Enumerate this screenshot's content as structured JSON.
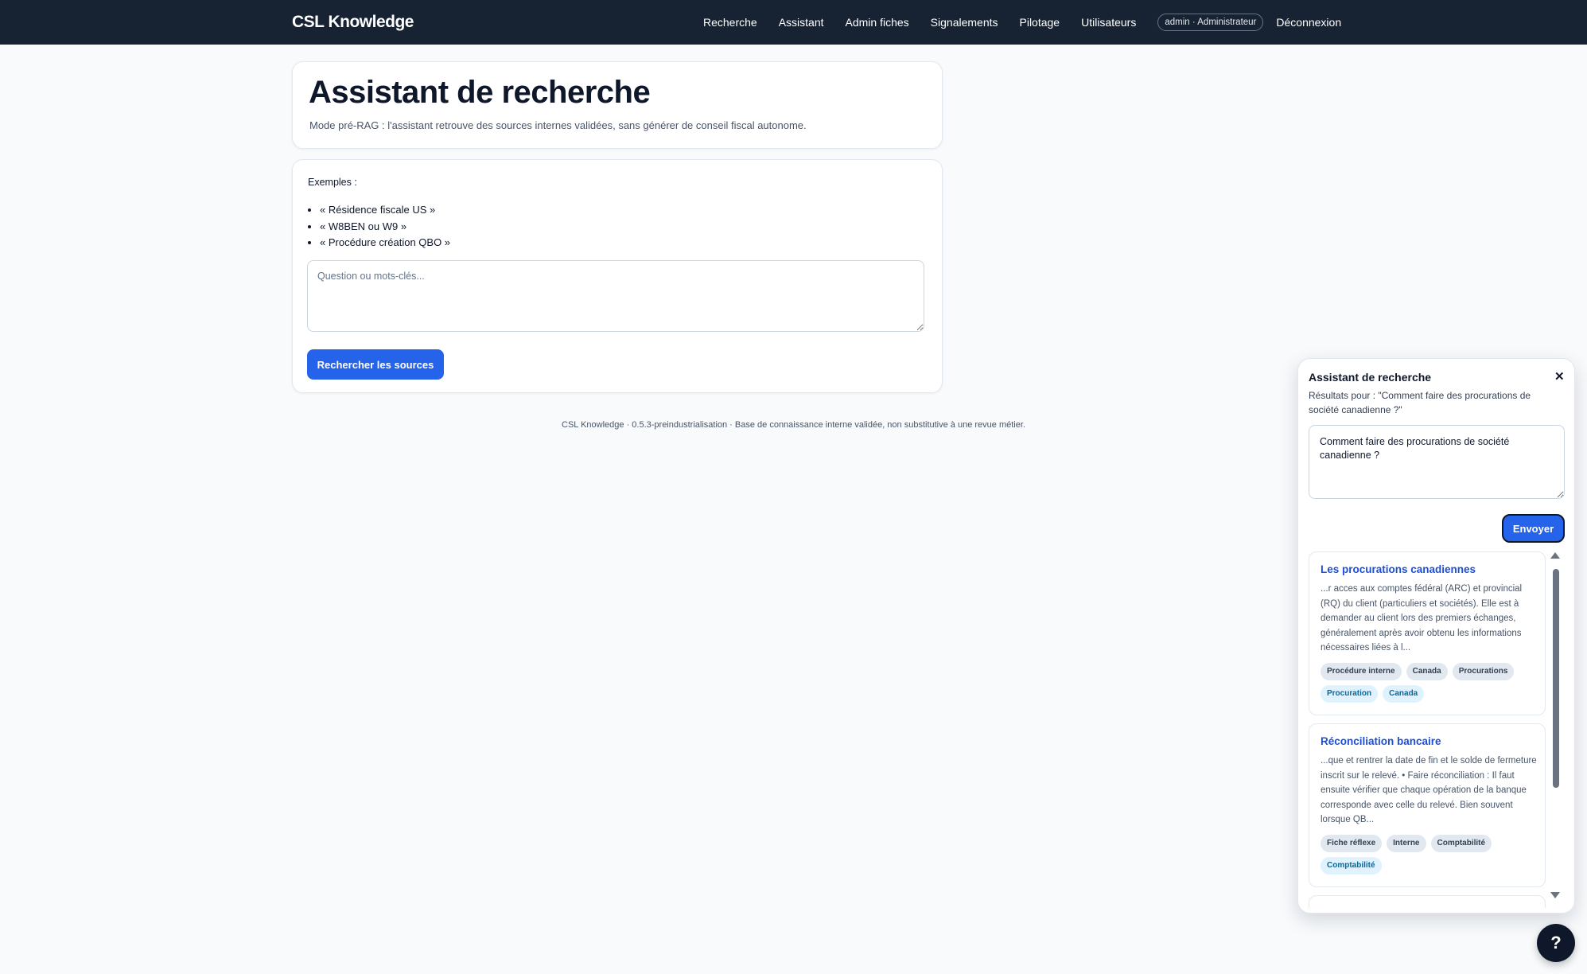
{
  "brand": "CSL Knowledge",
  "nav": {
    "items": [
      "Recherche",
      "Assistant",
      "Admin fiches",
      "Signalements",
      "Pilotage",
      "Utilisateurs"
    ],
    "user_badge": "admin · Administrateur",
    "logout": "Déconnexion"
  },
  "page": {
    "title": "Assistant de recherche",
    "subtitle": "Mode pré-RAG : l'assistant retrouve des sources internes validées, sans générer de conseil fiscal autonome."
  },
  "form": {
    "examples_label": "Exemples :",
    "examples": [
      "« Résidence fiscale US »",
      "« W8BEN ou W9 »",
      "« Procédure création QBO »"
    ],
    "query_placeholder": "Question ou mots-clés...",
    "query_value": "",
    "search_button": "Rechercher les sources"
  },
  "footer": "CSL Knowledge · 0.5.3-preindustrialisation · Base de connaissance interne validée, non substitutive à une revue métier.",
  "widget": {
    "title": "Assistant de recherche",
    "close_icon": "close-icon",
    "results_for": "Résultats pour : \"Comment faire des procurations de société canadienne ?\"",
    "input_value": "Comment faire des procurations de société canadienne ?",
    "send_button": "Envoyer",
    "results": [
      {
        "title": "Les procurations canadiennes",
        "excerpt": "...r acces aux comptes fédéral (ARC) et provincial (RQ) du client (particuliers et sociétés). Elle est à demander au client lors des premiers échanges, généralement après avoir obtenu les informations nécessaires liées à l...",
        "tags": [
          "Procédure interne",
          "Canada",
          "Procurations"
        ],
        "tags_blue": [
          "Procuration",
          "Canada"
        ]
      },
      {
        "title": "Réconciliation bancaire",
        "excerpt": "...que et rentrer la date de fin et le solde de fermeture inscrit sur le relevé. • Faire réconciliation : Il faut ensuite vérifier que chaque opération de la banque corresponde avec celle du relevé. Bien souvent lorsque QB...",
        "tags": [
          "Fiche réflexe",
          "Interne",
          "Comptabilité"
        ],
        "tags_blue": [
          "Comptabilité"
        ]
      }
    ]
  },
  "help_button": "?",
  "colors": {
    "nav_bg": "#172233",
    "primary": "#2563eb",
    "link": "#1d4ed8",
    "page_bg": "#f8fafc"
  }
}
